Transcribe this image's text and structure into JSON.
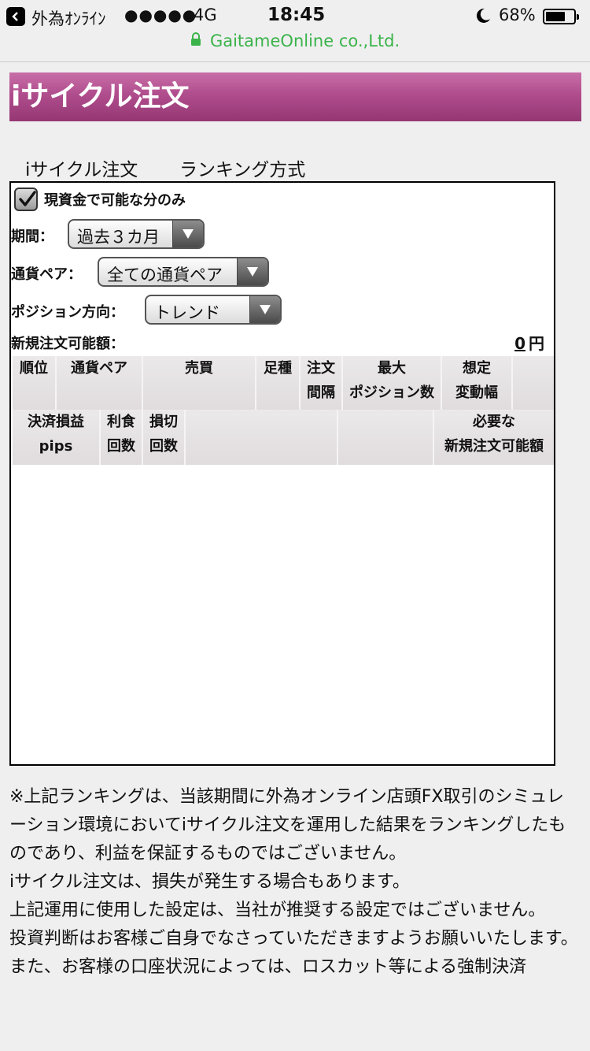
{
  "status_bar": {
    "carrier": "外為ｵﾝﾗｲﾝ",
    "signal": "●●●●●",
    "network": "4G",
    "time": "18:45",
    "battery_percent": "68%",
    "battery_level": 0.68
  },
  "browser": {
    "url": "GaitameOnline co.,Ltd."
  },
  "page": {
    "title": "iサイクル注文",
    "tabs": [
      "iサイクル注文",
      "ランキング方式"
    ],
    "checkbox_label": "現資金で可能な分のみ",
    "checkbox_checked": true,
    "period_label": "期間：",
    "period_value": "過去３カ月",
    "pair_label": "通貨ペア：",
    "pair_value": "全ての通貨ペア",
    "direction_label": "ポジション方向：",
    "direction_value": "トレンド",
    "available_label": "新規注文可能額：",
    "available_value": "0",
    "available_unit": "円"
  },
  "table": {
    "headers_row1": [
      [
        "順位"
      ],
      [
        "通貨ペア"
      ],
      [
        "売買"
      ],
      [
        "足種"
      ],
      [
        "注文",
        "間隔"
      ],
      [
        "最大",
        "ポジション数"
      ],
      [
        "想定",
        "変動幅"
      ],
      [
        ""
      ]
    ],
    "headers_row2": [
      [
        "決済損益",
        "pips"
      ],
      [
        "利食",
        "回数"
      ],
      [
        "損切",
        "回数"
      ],
      [
        ""
      ],
      [
        ""
      ],
      [
        "必要な",
        "新規注文可能額"
      ]
    ]
  },
  "notes": [
    "※上記ランキングは、当該期間に外為オンライン店頭FX取引のシミュレーション環境においてiサイクル注文を運用した結果をランキングしたものであり、利益を保証するものではございません。",
    "iサイクル注文は、損失が発生する場合もあります。",
    "上記運用に使用した設定は、当社が推奨する設定ではございません。",
    "投資判断はお客様ご自身でなさっていただきますようお願いいたします。",
    "また、お客様の口座状況によっては、ロスカット等による強制決済"
  ]
}
